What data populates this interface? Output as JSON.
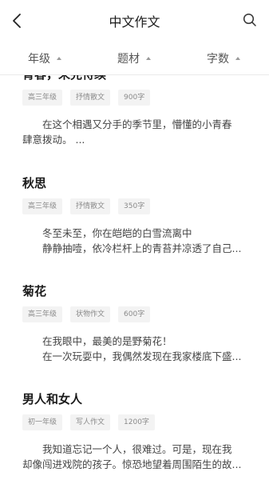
{
  "header": {
    "title": "中文作文",
    "back_icon": "chevron-left-icon",
    "search_icon": "search-icon"
  },
  "filters": [
    {
      "label": "年级",
      "icon": "caret-up-icon"
    },
    {
      "label": "题材",
      "icon": "caret-up-icon"
    },
    {
      "label": "字数",
      "icon": "caret-up-icon"
    }
  ],
  "articles": [
    {
      "title": "青春，未完待续",
      "tags": [
        "高三年级",
        "抒情散文",
        "900字"
      ],
      "excerpt": [
        "在这个相遇又分手的季节里，懵懂的小青春",
        "肆意拨动。 ..."
      ]
    },
    {
      "title": "秋思",
      "tags": [
        "高三年级",
        "抒情散文",
        "350字"
      ],
      "excerpt": [
        "冬至未至，你在皑皑的白雪流离中",
        "静静抽噎，依冷栏杆上的青苔并凉透了自己..."
      ]
    },
    {
      "title": "菊花",
      "tags": [
        "高三年级",
        "状物作文",
        "600字"
      ],
      "excerpt": [
        "在我眼中，最美的是野菊花！",
        "在一次玩耍中，我偶然发现在我家楼底下盛..."
      ]
    },
    {
      "title": "男人和女人",
      "tags": [
        "初一年级",
        "写人作文",
        "1200字"
      ],
      "excerpt": [
        "我知道忘记一个人，很难过。可是，现在我",
        "却像闯进戏院的孩子。惊恐地望着周围陌生的故..."
      ]
    }
  ]
}
